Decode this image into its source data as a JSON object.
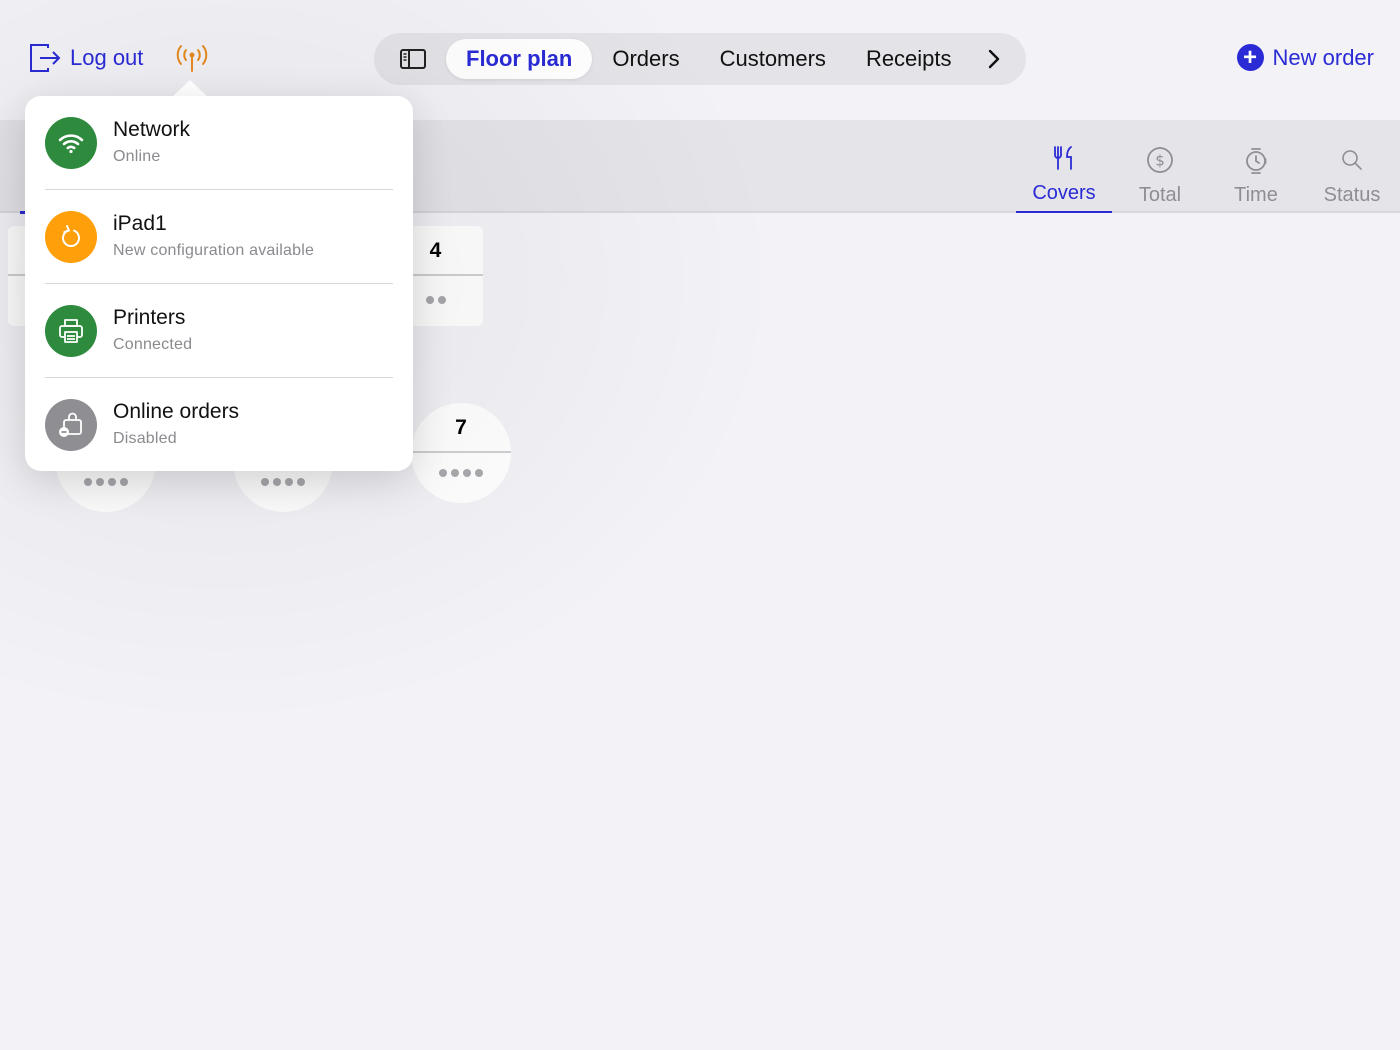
{
  "header": {
    "logout_label": "Log out",
    "status_icon": "antenna-icon",
    "tabs": [
      {
        "label": "Floor plan",
        "active": true
      },
      {
        "label": "Orders",
        "active": false
      },
      {
        "label": "Customers",
        "active": false
      },
      {
        "label": "Receipts",
        "active": false
      }
    ],
    "new_order_label": "New order",
    "accent_color": "#2b2bd6",
    "status_color": "#e88a1f"
  },
  "subbar": {
    "sort_tabs": [
      {
        "label": "Covers",
        "icon": "fork-knife-icon",
        "active": true
      },
      {
        "label": "Total",
        "icon": "dollar-circle-icon",
        "active": false
      },
      {
        "label": "Time",
        "icon": "watch-icon",
        "active": false
      },
      {
        "label": "Status",
        "icon": "magnifier-icon",
        "active": false
      }
    ]
  },
  "floor": {
    "tables": [
      {
        "number": "4",
        "shape": "rect",
        "seats": 2
      },
      {
        "number": "7",
        "shape": "round",
        "seats": 4
      }
    ]
  },
  "status_popover": {
    "items": [
      {
        "title": "Network",
        "subtitle": "Online",
        "icon": "wifi-icon",
        "color": "#2e8b3e"
      },
      {
        "title": "iPad1",
        "subtitle": "New configuration available",
        "icon": "refresh-icon",
        "color": "#ff9f0a"
      },
      {
        "title": "Printers",
        "subtitle": "Connected",
        "icon": "printer-icon",
        "color": "#2e8b3e"
      },
      {
        "title": "Online orders",
        "subtitle": "Disabled",
        "icon": "bag-disabled-icon",
        "color": "#8e8e93"
      }
    ]
  }
}
